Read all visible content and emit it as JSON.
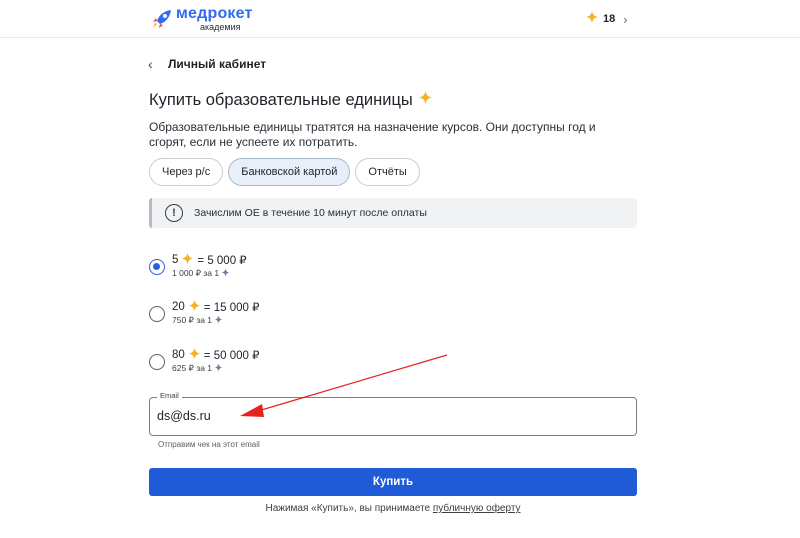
{
  "header": {
    "logo_main": "медрокет",
    "logo_sub": "академия",
    "balance": "18",
    "brand_color": "#2f6cf0",
    "star_color": "#f5b324"
  },
  "breadcrumb": {
    "back_label": "Личный кабинет"
  },
  "title": "Купить образовательные единицы",
  "description": "Образовательные единицы тратятся на назначение курсов. Они доступны год и сгорят, если не успеете их потратить.",
  "tabs": [
    {
      "label": "Через р/с",
      "active": false
    },
    {
      "label": "Банковской картой",
      "active": true
    },
    {
      "label": "Отчёты",
      "active": false
    }
  ],
  "info": {
    "text": "Зачислим ОЕ в течение 10 минут после оплаты",
    "icon": "exclamation-circle-icon"
  },
  "options": [
    {
      "count": "5",
      "price": "= 5 000 ₽",
      "unit_price": "1 000 ₽ за 1",
      "selected": true
    },
    {
      "count": "20",
      "price": "= 15 000 ₽",
      "unit_price": "750 ₽ за 1",
      "selected": false
    },
    {
      "count": "80",
      "price": "= 50 000 ₽",
      "unit_price": "625 ₽ за 1",
      "selected": false
    }
  ],
  "email": {
    "label": "Email",
    "value": "ds@ds.ru",
    "hint": "Отправим чек на этот email"
  },
  "buy_button": "Купить",
  "terms": {
    "prefix": "Нажимая «Купить», вы принимаете ",
    "link": "публичную оферту"
  },
  "accent_color": "#1f5bd6",
  "annotation_color": "#e82020"
}
